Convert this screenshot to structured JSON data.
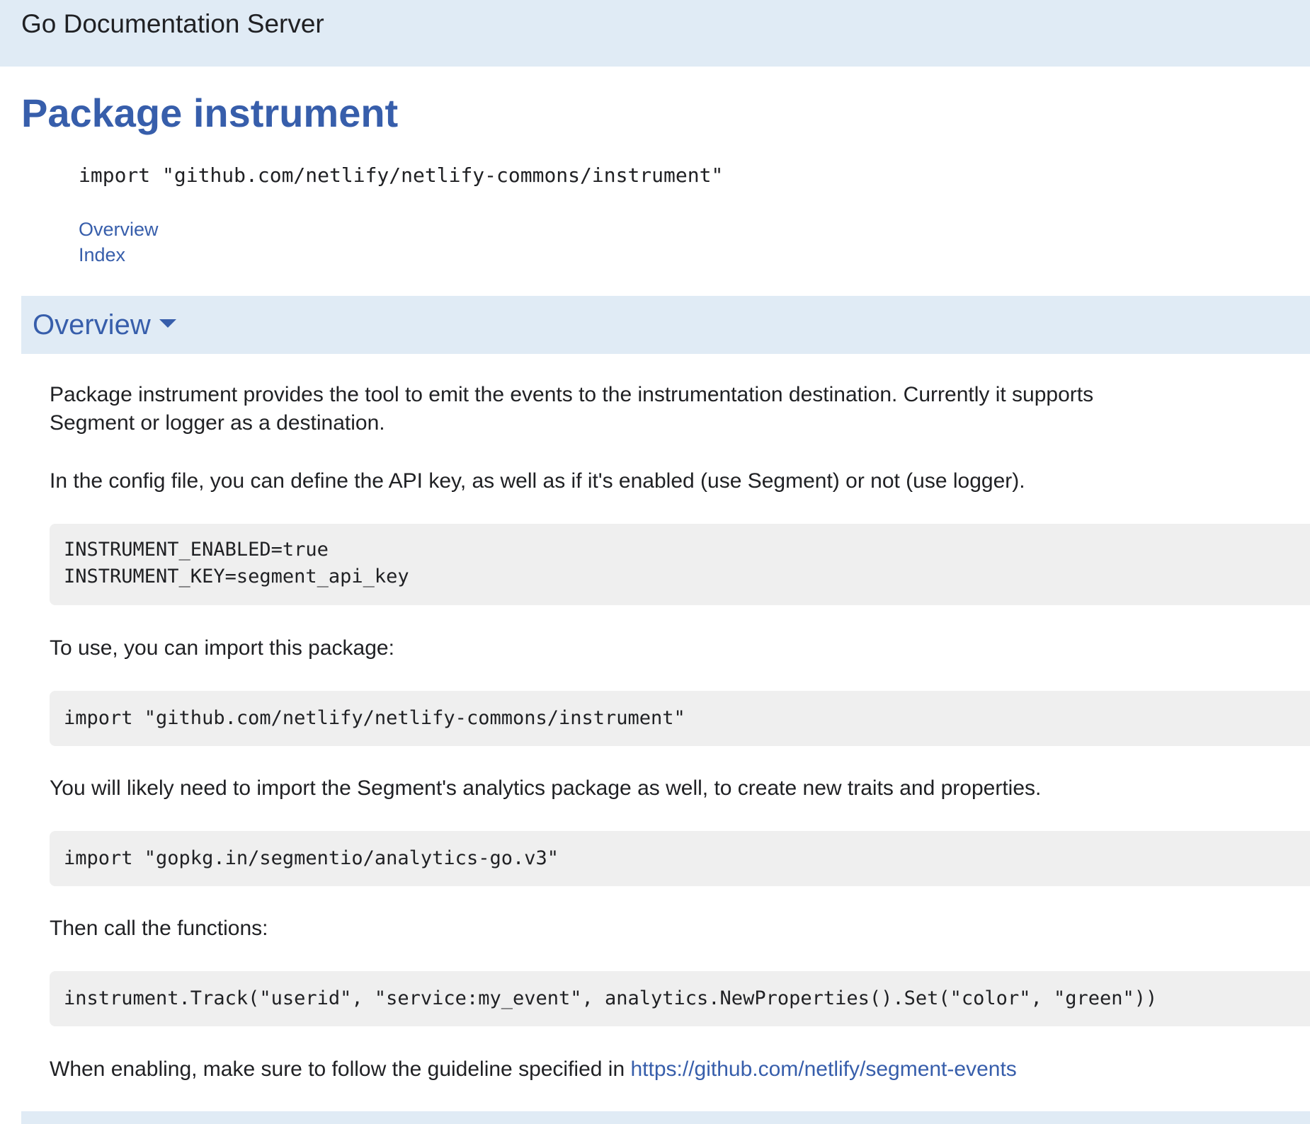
{
  "header": {
    "title": "Go Documentation Server"
  },
  "page": {
    "title": "Package instrument",
    "import_line": "import \"github.com/netlify/netlify-commons/instrument\"",
    "toc": [
      {
        "label": "Overview"
      },
      {
        "label": "Index"
      }
    ]
  },
  "overview": {
    "title": "Overview",
    "toggle_icon": "caret-down-icon",
    "paragraphs": [
      "Package instrument provides the tool to emit the events to the instrumentation destination. Currently it supports Segment or logger as a destination.",
      "In the config file, you can define the API key, as well as if it's enabled (use Segment) or not (use logger).",
      "To use, you can import this package:",
      "You will likely need to import the Segment's analytics package as well, to create new traits and properties.",
      "Then call the functions:"
    ],
    "code_blocks": [
      {
        "lines": [
          "INSTRUMENT_ENABLED=true",
          "INSTRUMENT_KEY=segment_api_key"
        ]
      },
      {
        "lines": [
          "import \"github.com/netlify/netlify-commons/instrument\""
        ]
      },
      {
        "lines": [
          "import \"gopkg.in/segmentio/analytics-go.v3\""
        ]
      },
      {
        "lines": [
          "instrument.Track(\"userid\", \"service:my_event\", analytics.NewProperties().Set(\"color\", \"green\"))"
        ]
      }
    ],
    "closing": {
      "text": "When enabling, make sure to follow the guideline specified in ",
      "link": "https://github.com/netlify/segment-events"
    }
  },
  "colors": {
    "banner_bg": "#E0EBF5",
    "link": "#375EAB",
    "code_bg": "#EFEFEF",
    "text": "#202124"
  }
}
